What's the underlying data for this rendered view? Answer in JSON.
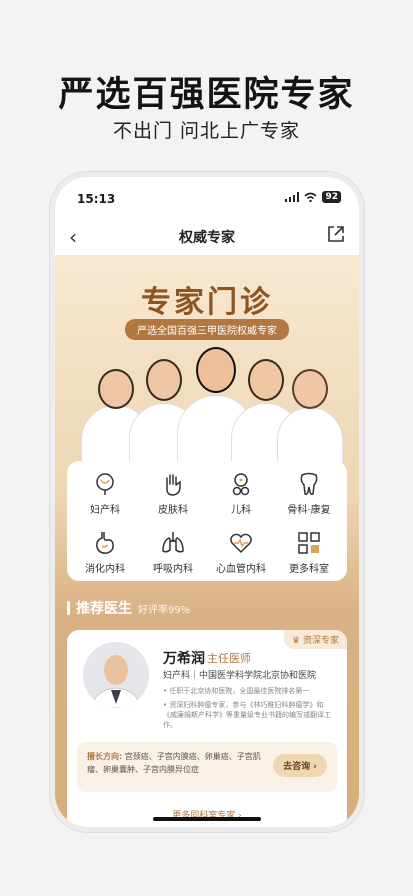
{
  "hero": {
    "title": "严选百强医院专家",
    "subtitle": "不出门 问北上广专家"
  },
  "status_bar": {
    "time": "15:13",
    "battery": "92"
  },
  "navbar": {
    "title": "权威专家"
  },
  "banner": {
    "title": "专家门诊",
    "pill": "严选全国百强三甲医院权威专家"
  },
  "departments": [
    {
      "label": "妇产科",
      "icon": "uterus-icon"
    },
    {
      "label": "皮肤科",
      "icon": "hand-icon"
    },
    {
      "label": "儿科",
      "icon": "baby-icon"
    },
    {
      "label": "骨科·康复",
      "icon": "tooth-bone-icon"
    },
    {
      "label": "消化内科",
      "icon": "stomach-icon"
    },
    {
      "label": "呼吸内科",
      "icon": "lungs-icon"
    },
    {
      "label": "心血管内科",
      "icon": "heart-icon"
    },
    {
      "label": "更多科室",
      "icon": "grid-icon"
    }
  ],
  "recommend": {
    "title": "推荐医生",
    "rate": "好评率99%"
  },
  "doctor": {
    "badge": "资深专家",
    "name": "万希润",
    "title": "主任医师",
    "department": "妇产科｜中国医学科学院北京协和医院",
    "line1": "任职于北京协和医院，全国最佳医院排名第一",
    "line2": "资深妇科肿瘤专家，参与《林巧稚妇科肿瘤学》和《威廉姆斯产科学》等重量级专业书籍的编写或翻译工作。",
    "skill_label": "擅长方向:",
    "skills": "宫颈癌、子宫内膜癌、卵巢癌、子宫肌瘤、卵巢囊肿、子宫内膜异位症",
    "consult": "去咨询 ›",
    "more": "更多同科室专家 ›"
  },
  "colors": {
    "accent": "#b27840",
    "banner_top": "#f7e8d1",
    "banner_bottom": "#d9ad7b"
  }
}
